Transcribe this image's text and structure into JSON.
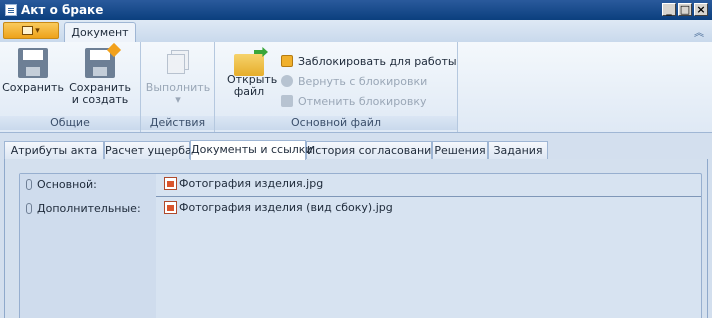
{
  "window": {
    "title": "Акт о браке",
    "controls": {
      "minimize": "_",
      "maximize": "□",
      "close": "×"
    }
  },
  "ribbon_tabs": {
    "active": "Документ"
  },
  "ribbon": {
    "groups": {
      "general": {
        "label": "Общие",
        "save": "Сохранить",
        "save_create": "Сохранить и создать"
      },
      "actions": {
        "label": "Действия",
        "execute": "Выполнить",
        "execute_arrow": "▾"
      },
      "main_file": {
        "label": "Основной файл",
        "open_file": "Открыть файл",
        "lock": "Заблокировать для работы",
        "revert": "Вернуть с блокировки",
        "cancel_lock": "Отменить блокировку"
      }
    }
  },
  "subtabs": [
    {
      "label": "Атрибуты акта",
      "active": false
    },
    {
      "label": "Расчет ущерба",
      "active": false
    },
    {
      "label": "Документы и ссылки",
      "active": true
    },
    {
      "label": "История согласования",
      "active": false
    },
    {
      "label": "Решения",
      "active": false
    },
    {
      "label": "Задания",
      "active": false
    }
  ],
  "files": {
    "main": {
      "label": "Основной:",
      "file": "Фотография изделия.jpg"
    },
    "additional": {
      "label": "Дополнительные:",
      "file": "Фотография изделия (вид сбоку).jpg"
    }
  },
  "icons": {
    "window": "document-icon",
    "collapse": "collapse-ribbon-icon",
    "attachment": "paperclip-icon",
    "image": "image-file-icon"
  },
  "colors": {
    "title_bar": "#0b3f7e",
    "app_button": "#eea21a",
    "panel": "#d7e3f1"
  }
}
